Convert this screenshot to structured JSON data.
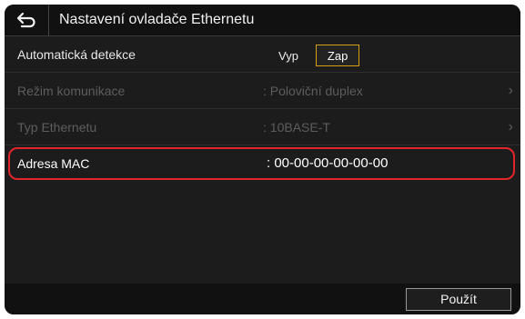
{
  "header": {
    "back_icon": "back-arrow-icon",
    "title": "Nastavení ovladače Ethernetu"
  },
  "rows": [
    {
      "label": "Automatická detekce",
      "toggle": {
        "options": [
          "Vyp",
          "Zap"
        ],
        "selected": "Zap"
      }
    },
    {
      "label": "Režim komunikace",
      "value": ": Poloviční duplex",
      "enabled": false
    },
    {
      "label": "Typ Ethernetu",
      "value": ": 10BASE-T",
      "enabled": false
    },
    {
      "label": "Adresa MAC",
      "value": ":  00-00-00-00-00-00",
      "highlighted": true
    }
  ],
  "footer": {
    "apply_label": "Použít"
  },
  "colors": {
    "accent": "#d4a017",
    "highlight": "#e0262b"
  }
}
